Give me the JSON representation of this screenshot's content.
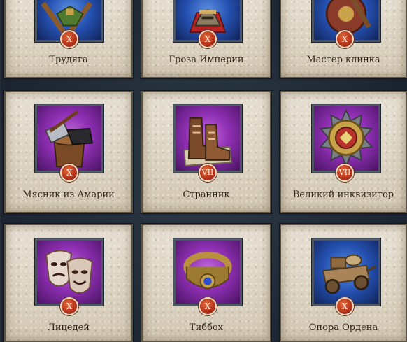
{
  "achievements": [
    {
      "name": "Трудяга",
      "badge": "X",
      "bg": "blue",
      "icon": "crossed-tools-icon"
    },
    {
      "name": "Гроза Империи",
      "badge": "X",
      "bg": "blue",
      "icon": "imperial-helmet-icon"
    },
    {
      "name": "Мастер клинка",
      "badge": "X",
      "bg": "blue",
      "icon": "shield-and-sword-icon"
    },
    {
      "name": "Мясник из Амарии",
      "badge": "X",
      "bg": "purple",
      "icon": "butcher-block-icon"
    },
    {
      "name": "Странник",
      "badge": "VII",
      "bg": "purple",
      "icon": "boots-icon"
    },
    {
      "name": "Великий инквизитор",
      "badge": "VII",
      "bg": "purple",
      "icon": "spiked-seal-icon"
    },
    {
      "name": "Лицедей",
      "badge": "X",
      "bg": "purple",
      "icon": "theater-masks-icon"
    },
    {
      "name": "Тиббох",
      "badge": "X",
      "bg": "purple",
      "icon": "ring-icon"
    },
    {
      "name": "Опора Ордена",
      "badge": "X",
      "bg": "blue",
      "icon": "supply-cart-icon"
    }
  ]
}
